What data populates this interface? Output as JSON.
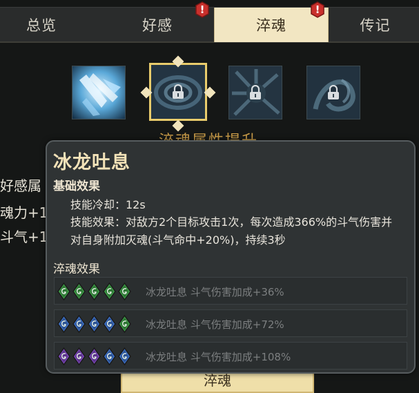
{
  "tabs": [
    {
      "label": "总览",
      "active": false,
      "alert": false
    },
    {
      "label": "好感",
      "active": false,
      "alert": true
    },
    {
      "label": "淬魂",
      "active": true,
      "alert": true
    },
    {
      "label": "传记",
      "active": false,
      "alert": false
    }
  ],
  "alert_symbol": "!",
  "skills": [
    {
      "name": "ice-dragon-skill",
      "locked": false,
      "selected": false
    },
    {
      "name": "swirl-skill-1",
      "locked": true,
      "selected": true
    },
    {
      "name": "swirl-skill-2",
      "locked": true,
      "selected": false
    },
    {
      "name": "swirl-skill-3",
      "locked": true,
      "selected": false
    }
  ],
  "background_heading": "淬魂属性提升",
  "left_panel": {
    "line1": "好感属",
    "line2": "魂力+1",
    "line3": "斗气+1"
  },
  "bottom_button": "淬魂",
  "tooltip": {
    "title": "冰龙吐息",
    "base_section": "基础效果",
    "cooldown": "技能冷却：12s",
    "effect": "技能效果：对敌方2个目标攻击1次，每次造成366%的斗气伤害并对自身附加灭魂(斗气命中+20%)，持续3秒",
    "temper_section": "淬魂效果",
    "effects": [
      {
        "text": "冰龙吐息 斗气伤害加成+36%",
        "gems": [
          "green",
          "green",
          "green",
          "green",
          "green"
        ]
      },
      {
        "text": "冰龙吐息 斗气伤害加成+72%",
        "gems": [
          "blue",
          "blue",
          "blue",
          "blue",
          "green"
        ]
      },
      {
        "text": "冰龙吐息 斗气伤害加成+108%",
        "gems": [
          "purple",
          "purple",
          "purple",
          "blue",
          "blue"
        ]
      }
    ]
  },
  "colors": {
    "accent_gold": "#e9cc6c",
    "active_tab": "#f2e6c2",
    "alert_red": "#c9302c",
    "gem_green": "#3c9a45",
    "gem_blue": "#3c6fc4",
    "gem_purple": "#7a46b8"
  }
}
